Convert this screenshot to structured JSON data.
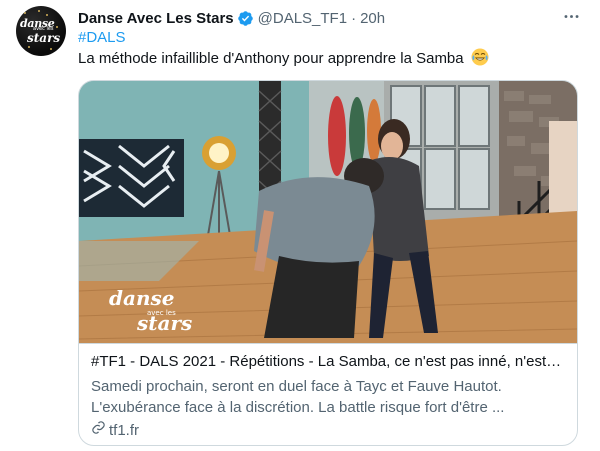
{
  "account": {
    "display_name": "Danse Avec Les Stars",
    "handle": "@DALS_TF1",
    "separator": "·",
    "time": "20h",
    "avatar_text": {
      "line1": "danse",
      "line2": "avec les",
      "line3": "stars"
    }
  },
  "tweet": {
    "hashtag": "#DALS",
    "text": "La méthode infaillible d'Anthony pour apprendre la Samba",
    "emoji": "face-with-tears-of-joy"
  },
  "card": {
    "watermark": {
      "line1": "danse",
      "line2": "avec les",
      "line3": "stars"
    },
    "title": "#TF1 - DALS 2021 - Répétitions - La Samba, ce n'est pas inné, n'est c...",
    "description_line1": "Samedi prochain, seront en duel face à Tayc et Fauve Hautot.",
    "description_line2": "L'exubérance face à la discrétion. La battle risque fort d'être ...",
    "domain": "tf1.fr"
  },
  "colors": {
    "link": "#1d9bf0",
    "secondary_text": "#536471",
    "primary_text": "#0f1419",
    "border": "#cfd9de",
    "verified": "#1d9bf0"
  },
  "icons": [
    "verified-badge-icon",
    "more-options-icon",
    "link-icon",
    "laughing-emoji-icon"
  ]
}
